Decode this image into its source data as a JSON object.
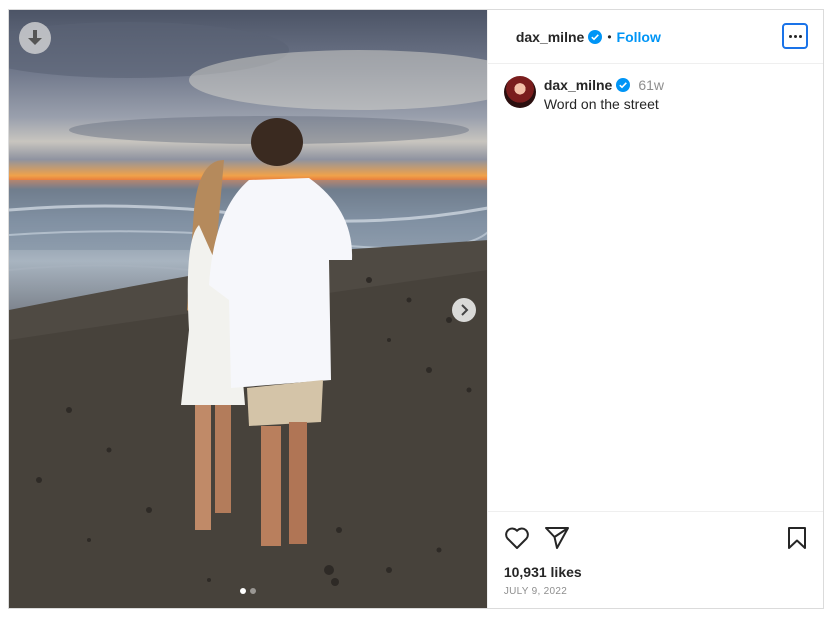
{
  "post": {
    "username": "dax_milne",
    "follow_label": "Follow",
    "separator": "•",
    "caption_username": "dax_milne",
    "time_ago": "61w",
    "caption_text": "Word on the street",
    "likes": "10,931 likes",
    "date": "JULY 9, 2022"
  },
  "carousel": {
    "total_slides": 2,
    "current_slide": 1
  },
  "icons": {
    "download": "download-arrow-icon",
    "next": "chevron-right-icon",
    "verified": "verified-badge-icon",
    "more": "more-options-icon",
    "like": "heart-icon",
    "share": "send-icon",
    "save": "bookmark-icon"
  },
  "colors": {
    "accent": "#0095f6",
    "verified": "#0095f6",
    "focus_ring": "#1a73e8"
  }
}
